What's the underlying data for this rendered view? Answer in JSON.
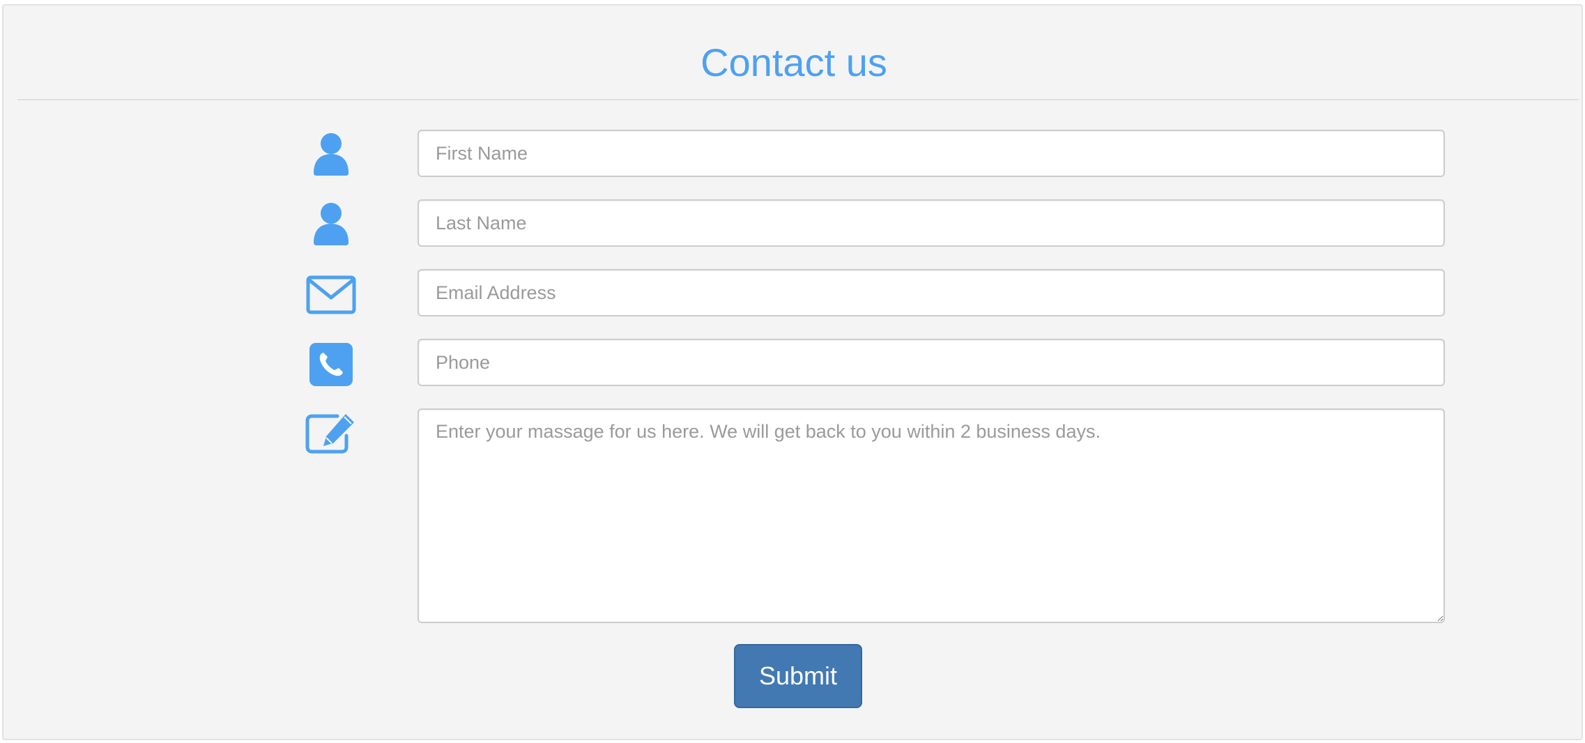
{
  "form": {
    "title": "Contact us",
    "fields": {
      "first_name": {
        "placeholder": "First Name",
        "value": "",
        "icon": "user-icon"
      },
      "last_name": {
        "placeholder": "Last Name",
        "value": "",
        "icon": "user-icon"
      },
      "email": {
        "placeholder": "Email Address",
        "value": "",
        "icon": "envelope-icon"
      },
      "phone": {
        "placeholder": "Phone",
        "value": "",
        "icon": "phone-icon"
      },
      "message": {
        "placeholder": "Enter your massage for us here. We will get back to you within 2 business days.",
        "value": "",
        "icon": "edit-icon"
      }
    },
    "submit_label": "Submit"
  },
  "colors": {
    "accent": "#4da1f0",
    "button": "#4279b2",
    "panel_background": "#f4f4f4"
  }
}
